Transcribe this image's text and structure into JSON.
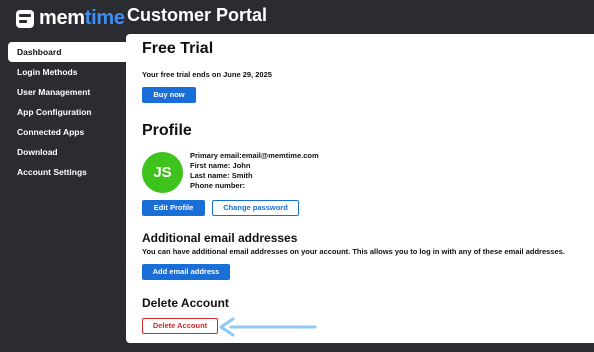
{
  "brand": {
    "name_part1": "mem",
    "name_part2": "time",
    "portal_title": "Customer Portal"
  },
  "sidebar": {
    "items": [
      {
        "label": "Dashboard"
      },
      {
        "label": "Login Methods"
      },
      {
        "label": "User Management"
      },
      {
        "label": "App Configuration"
      },
      {
        "label": "Connected Apps"
      },
      {
        "label": "Download"
      },
      {
        "label": "Account Settings"
      }
    ]
  },
  "trial": {
    "title": "Free Trial",
    "message": "Your free trial ends on June 29, 2025",
    "buy_label": "Buy now"
  },
  "profile": {
    "title": "Profile",
    "initials": "JS",
    "primary_email_label": "Primary email:",
    "primary_email": "email@memtime.com",
    "first_name_label": "First name:",
    "first_name": "John",
    "last_name_label": "Last name:",
    "last_name": "Smith",
    "phone_label": "Phone number:",
    "phone": "",
    "edit_label": "Edit Profile",
    "password_label": "Change password"
  },
  "emails": {
    "title": "Additional email addresses",
    "description": "You can have additional email addresses on your account. This allows you to log in with any of these email addresses.",
    "add_label": "Add email address"
  },
  "delete": {
    "title": "Delete Account",
    "button_label": "Delete Account"
  },
  "colors": {
    "background": "#2b2c31",
    "accent": "#1a6ed8",
    "brand_blue": "#3d8df5",
    "avatar": "#3ec21c",
    "danger": "#d22a2a",
    "arrow": "#8fc9f5"
  },
  "icons": {
    "logo": "memtime-logo-icon",
    "arrow": "left-arrow-icon"
  }
}
